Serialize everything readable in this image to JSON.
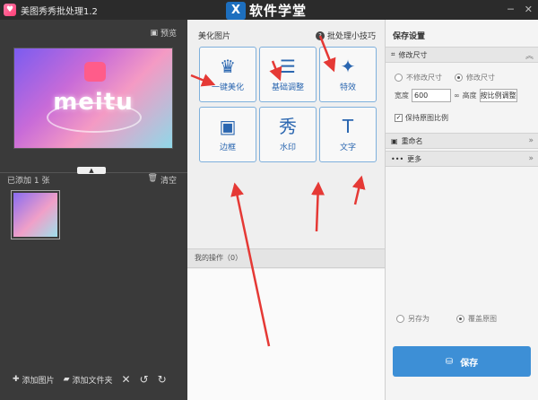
{
  "window": {
    "title": "美图秀秀批处理1.2",
    "brand_logo_text": "X",
    "brand_text": "软件学堂",
    "btn_minimize": "─",
    "btn_close": "✕"
  },
  "left": {
    "preview_label": "预览",
    "preview_art_text": "meitu",
    "added_label": "已添加 1 张",
    "clear_label": "清空",
    "add_image_label": "添加图片",
    "add_folder_label": "添加文件夹"
  },
  "center": {
    "heading": "美化图片",
    "tips_label": "批处理小技巧",
    "tiles": [
      {
        "label": "一键美化",
        "glyph": "♛"
      },
      {
        "label": "基础调整",
        "glyph": "☰"
      },
      {
        "label": "特效",
        "glyph": "✦"
      },
      {
        "label": "边框",
        "glyph": "▣"
      },
      {
        "label": "水印",
        "glyph": "秀"
      },
      {
        "label": "文字",
        "glyph": "T"
      }
    ],
    "my_ops_label": "我的操作（0）"
  },
  "right": {
    "title": "保存设置",
    "resize_section": "修改尺寸",
    "no_resize": "不修改尺寸",
    "resize": "修改尺寸",
    "width_label": "宽度",
    "width_value": "600",
    "height_label": "高度",
    "ratio_label": "按比例调整",
    "keep_ratio": "保持原图比例",
    "rename_section": "重命名",
    "more_section": "更多",
    "save_as": "另存为",
    "overwrite": "覆盖原图",
    "save_button": "保存"
  },
  "colors": {
    "accent": "#3d8fd6",
    "tile_border": "#7fb0dc",
    "arrow": "#e53935"
  }
}
